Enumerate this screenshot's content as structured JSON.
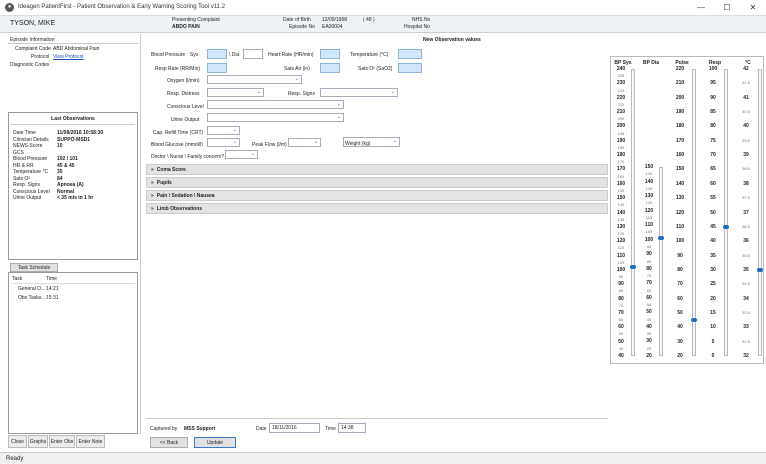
{
  "window": {
    "title": "Ideagen PatientFirst - Patient Observation & Early Warning Scoring Tool v11.2",
    "app_icon": "person-icon"
  },
  "patient": {
    "name": "TYSON, MIKE",
    "presenting_complaint_label": "Presenting Complaint",
    "presenting_complaint": "ABDO PAIN",
    "dob_label": "Date of Birth",
    "dob": "12/09/1968",
    "age": "( 48 )",
    "episode_label": "Episode No",
    "episode": "EA00004",
    "nhs_label": "NHS No",
    "hospital_label": "Hospital No"
  },
  "episode_info": {
    "title": "Episode Information",
    "complaint_code_label": "Complaint Code",
    "complaint_code": "ABD Abdominal Pain",
    "protocol_label": "Protocol",
    "protocol_link": "View Protocol",
    "diagnostic_label": "Diagnostic Codes"
  },
  "last_obs": {
    "title": "Last Observations",
    "rows": [
      {
        "label": "Date Time",
        "value": "11/08/2016 10:58:30"
      },
      {
        "label": "Clinician Details",
        "value": "SUPPO-MSD1"
      },
      {
        "label": "NEWS Score",
        "value": "10"
      },
      {
        "label": "GCS",
        "value": ""
      },
      {
        "label": "Blood Pressure",
        "value": "102 / 101"
      },
      {
        "label": "HR & RR",
        "value": "45 & 45"
      },
      {
        "label": "Temperature °C",
        "value": "35"
      },
      {
        "label": "Sats O²",
        "value": "84"
      },
      {
        "label": "Resp. Signs",
        "value": "Apnoea (A)"
      },
      {
        "label": "Conscious Level",
        "value": "Normal"
      },
      {
        "label": "Urine Output",
        "value": "< 35 mls in 1 hr"
      }
    ]
  },
  "task_schedule": {
    "tab_label": "Task Schedule",
    "col_task": "Task",
    "col_time": "Time",
    "rows": [
      {
        "task": "General O...",
        "time": "14:21"
      },
      {
        "task": "Obs Tasks...",
        "time": "15:31"
      }
    ]
  },
  "bottom_tabs": [
    "Close",
    "Graphs",
    "Enter Obs",
    "Enter Note"
  ],
  "form": {
    "header": "New Observation values",
    "bp_label": "Blood Pressure",
    "sys_label": "Sys",
    "dia_label": "\\ Dia",
    "hr_label": "Heart Rate (HR/min)",
    "temp_label": "Temperature (°C)",
    "resp_rate_label": "Resp Rate (RR/Min)",
    "sats_air_label": "Sats Air (in)",
    "sats_o2_label": "Sats O² (SaO2)",
    "oxygen_label": "Oxygen (l/min)",
    "resp_distress_label": "Resp. Distress",
    "resp_signs_label": "Resp. Signs",
    "conscious_label": "Conscious Level",
    "urine_label": "Urine Output",
    "cap_refill_label": "Cap. Refill Time (CRT)",
    "glucose_label": "Blood Glucose (mmol/l)",
    "peak_flow_label": "Peak Flow (l/m)",
    "weight_label": "Weight (kg)",
    "doctor_label": "Doctor \\ Nurse \\ Family concern?",
    "sections": [
      "Coma Score",
      "Pupils",
      "Pain \\ Sedation \\ Nausea",
      "Limb Observations"
    ],
    "section_icon": "double-chevron-right-icon",
    "captured_by_label": "Captured by",
    "captured_by": "MSS Support",
    "date_label": "Date",
    "date": "18/11/2016",
    "time_label": "Time",
    "time": "14:38",
    "back_label": "<< Back",
    "update_label": "Update"
  },
  "vitals_chart": {
    "columns": [
      {
        "key": "bp_sys",
        "header": "BP Sys",
        "ticks": [
          "240",
          "235",
          "230",
          "225",
          "220",
          "215",
          "210",
          "205",
          "200",
          "195",
          "190",
          "185",
          "180",
          "175",
          "170",
          "165",
          "160",
          "155",
          "150",
          "145",
          "140",
          "135",
          "130",
          "125",
          "120",
          "115",
          "110",
          "105",
          "100",
          "95",
          "90",
          "85",
          "80",
          "75",
          "70",
          "65",
          "60",
          "55",
          "50",
          "45",
          "40"
        ],
        "value": 102,
        "min": 40,
        "max": 240
      },
      {
        "key": "bp_dia",
        "header": "BP Dia",
        "ticks": [
          "150",
          "145",
          "140",
          "135",
          "130",
          "125",
          "120",
          "115",
          "110",
          "105",
          "100",
          "95",
          "90",
          "85",
          "80",
          "75",
          "70",
          "65",
          "60",
          "55",
          "50",
          "45",
          "40",
          "35",
          "30",
          "25",
          "20"
        ],
        "value": 101,
        "min": 20,
        "max": 150
      },
      {
        "key": "pulse",
        "header": "Pulse",
        "ticks": [
          "220",
          "210",
          "200",
          "190",
          "180",
          "170",
          "160",
          "150",
          "140",
          "130",
          "120",
          "110",
          "100",
          "90",
          "80",
          "70",
          "60",
          "50",
          "40",
          "30",
          "20"
        ],
        "value": 45,
        "min": 20,
        "max": 220
      },
      {
        "key": "resp",
        "header": "Resp",
        "ticks": [
          "100",
          "95",
          "90",
          "85",
          "80",
          "75",
          "70",
          "65",
          "60",
          "55",
          "50",
          "45",
          "40",
          "35",
          "30",
          "25",
          "20",
          "15",
          "10",
          "5",
          "0"
        ],
        "value": 45,
        "min": 0,
        "max": 100
      },
      {
        "key": "temp",
        "header": "°C",
        "ticks": [
          "42",
          "41.5",
          "41",
          "40.5",
          "40",
          "39.5",
          "39",
          "38.5",
          "38",
          "37.5",
          "37",
          "36.5",
          "36",
          "35.5",
          "35",
          "34.5",
          "34",
          "33.5",
          "33",
          "32.5",
          "32"
        ],
        "value": 35,
        "min": 32,
        "max": 42
      }
    ]
  },
  "status": {
    "text": "Ready"
  }
}
